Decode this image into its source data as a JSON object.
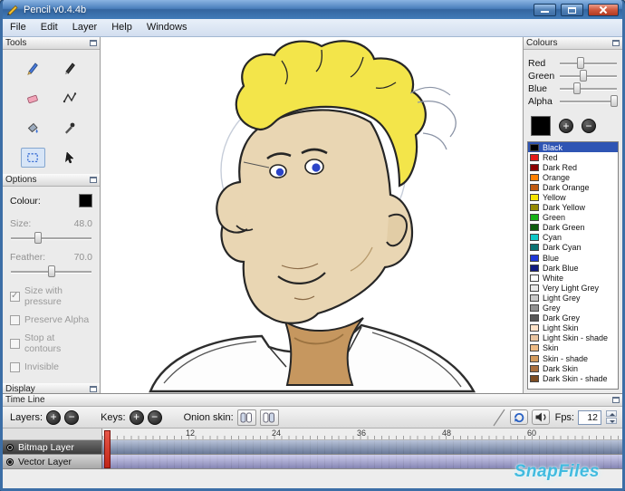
{
  "window": {
    "title": "Pencil v0.4.4b",
    "buttons": [
      "minimize",
      "maximize",
      "close"
    ]
  },
  "icons": {
    "plus": "+",
    "minus": "−"
  },
  "menu": {
    "items": [
      "File",
      "Edit",
      "Layer",
      "Help",
      "Windows"
    ]
  },
  "tools_panel": {
    "title": "Tools",
    "tools": [
      "pencil",
      "pen",
      "eraser",
      "polyline",
      "bucket",
      "eyedropper",
      "select",
      "move"
    ],
    "selected_tool": "select"
  },
  "options_panel": {
    "title": "Options",
    "colour_label": "Colour:",
    "size_label": "Size:",
    "size_value": "48.0",
    "feather_label": "Feather:",
    "feather_value": "70.0",
    "checkboxes": [
      {
        "label": "Size with pressure",
        "checked": true
      },
      {
        "label": "Preserve Alpha",
        "checked": false
      },
      {
        "label": "Stop at contours",
        "checked": false
      },
      {
        "label": "Invisible",
        "checked": false
      }
    ]
  },
  "display_panel": {
    "title": "Display",
    "buttons": [
      "mirror-horizontal",
      "shading-a",
      "shading-b"
    ]
  },
  "colours_panel": {
    "title": "Colours",
    "sliders": [
      {
        "label": "Red",
        "pos": "30%"
      },
      {
        "label": "Green",
        "pos": "36%"
      },
      {
        "label": "Blue",
        "pos": "24%"
      },
      {
        "label": "Alpha",
        "pos": "88%"
      }
    ],
    "current_color": "#000000",
    "palette": [
      {
        "name": "Black",
        "color": "#000000",
        "selected": true
      },
      {
        "name": "Red",
        "color": "#e31b1b"
      },
      {
        "name": "Dark Red",
        "color": "#8b0000"
      },
      {
        "name": "Orange",
        "color": "#ff8000"
      },
      {
        "name": "Dark Orange",
        "color": "#c05a11"
      },
      {
        "name": "Yellow",
        "color": "#f5e400"
      },
      {
        "name": "Dark Yellow",
        "color": "#948900"
      },
      {
        "name": "Green",
        "color": "#17b117"
      },
      {
        "name": "Dark Green",
        "color": "#0d5c0d"
      },
      {
        "name": "Cyan",
        "color": "#0fc7c7"
      },
      {
        "name": "Dark Cyan",
        "color": "#0b7272"
      },
      {
        "name": "Blue",
        "color": "#2038d8"
      },
      {
        "name": "Dark Blue",
        "color": "#101a80"
      },
      {
        "name": "White",
        "color": "#ffffff"
      },
      {
        "name": "Very Light Grey",
        "color": "#e8e8e8"
      },
      {
        "name": "Light Grey",
        "color": "#c9c9c9"
      },
      {
        "name": "Grey",
        "color": "#929292"
      },
      {
        "name": "Dark Grey",
        "color": "#575757"
      },
      {
        "name": "Light Skin",
        "color": "#ffe2c8"
      },
      {
        "name": "Light Skin - shade",
        "color": "#eac5a1"
      },
      {
        "name": "Skin",
        "color": "#eebb85"
      },
      {
        "name": "Skin - shade",
        "color": "#d39b5d"
      },
      {
        "name": "Dark Skin",
        "color": "#a96f3d"
      },
      {
        "name": "Dark Skin - shade",
        "color": "#7c4c22"
      }
    ]
  },
  "timeline": {
    "title": "Time Line",
    "layers_label": "Layers:",
    "keys_label": "Keys:",
    "onion_label": "Onion skin:",
    "fps_label": "Fps:",
    "fps_value": "12",
    "ruler_numbers": [
      {
        "label": "12",
        "pos": "92px"
      },
      {
        "label": "24",
        "pos": "187px"
      },
      {
        "label": "36",
        "pos": "281px"
      },
      {
        "label": "48",
        "pos": "375px"
      },
      {
        "label": "60",
        "pos": "469px"
      }
    ],
    "playback_buttons": [
      "loop",
      "sound"
    ],
    "layers": [
      {
        "name": "Bitmap Layer",
        "selected": true,
        "track_color": "#8093ba"
      },
      {
        "name": "Vector Layer",
        "selected": false,
        "track_color": "#a3a3dc"
      }
    ]
  },
  "watermark": {
    "text": "SnapFiles"
  }
}
